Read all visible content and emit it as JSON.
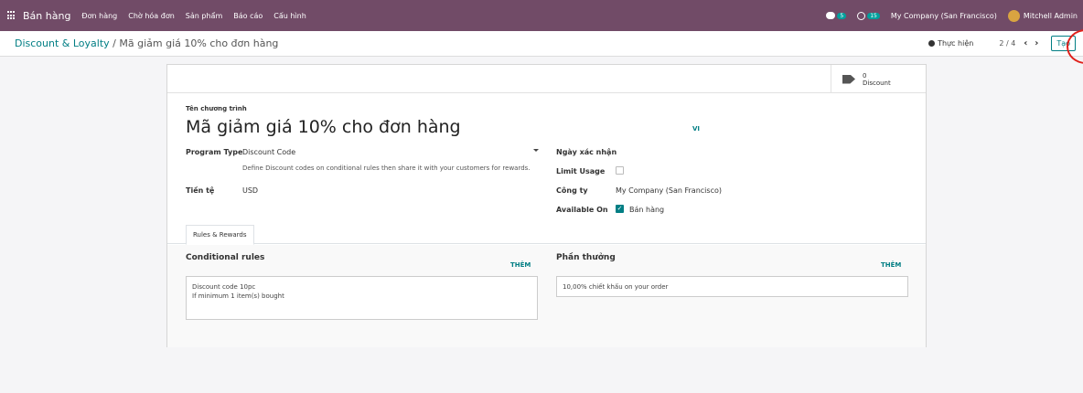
{
  "navbar": {
    "app_name": "Bán hàng",
    "menu": [
      "Đơn hàng",
      "Chờ hóa đơn",
      "Sản phẩm",
      "Báo cáo",
      "Cấu hình"
    ],
    "chat_count": "5",
    "activity_count": "15",
    "company": "My Company (San Francisco)",
    "user": "Mitchell Admin"
  },
  "control": {
    "breadcrumb_parent": "Discount & Loyalty",
    "breadcrumb_sep": " / ",
    "breadcrumb_current": "Mã giảm giá 10% cho đơn hàng",
    "action_label": "Thực hiện",
    "pager": "2 / 4",
    "create_label": "Tạo"
  },
  "smart_button": {
    "count": "0",
    "label": "Discount"
  },
  "form": {
    "name_label": "Tên chương trình",
    "name": "Mã giảm giá 10% cho đơn hàng",
    "lang": "VI",
    "program_type_label": "Program Type",
    "program_type": "Discount Code",
    "program_type_hint": "Define Discount codes on conditional rules then share it with your customers for rewards.",
    "currency_label": "Tiền tệ",
    "currency": "USD",
    "validity_label": "Ngày xác nhận",
    "limit_usage_label": "Limit Usage",
    "company_label": "Công ty",
    "company": "My Company (San Francisco)",
    "available_on_label": "Available On",
    "available_on": "Bán hàng"
  },
  "tabs": {
    "rules_rewards": "Rules & Rewards"
  },
  "rules": {
    "title": "Conditional rules",
    "add": "THÊM",
    "line1": "Discount code 10pc",
    "line2": "If minimum 1 item(s) bought"
  },
  "rewards": {
    "title": "Phần thưởng",
    "add": "THÊM",
    "line1": "10,00% chiết khấu on your order"
  }
}
